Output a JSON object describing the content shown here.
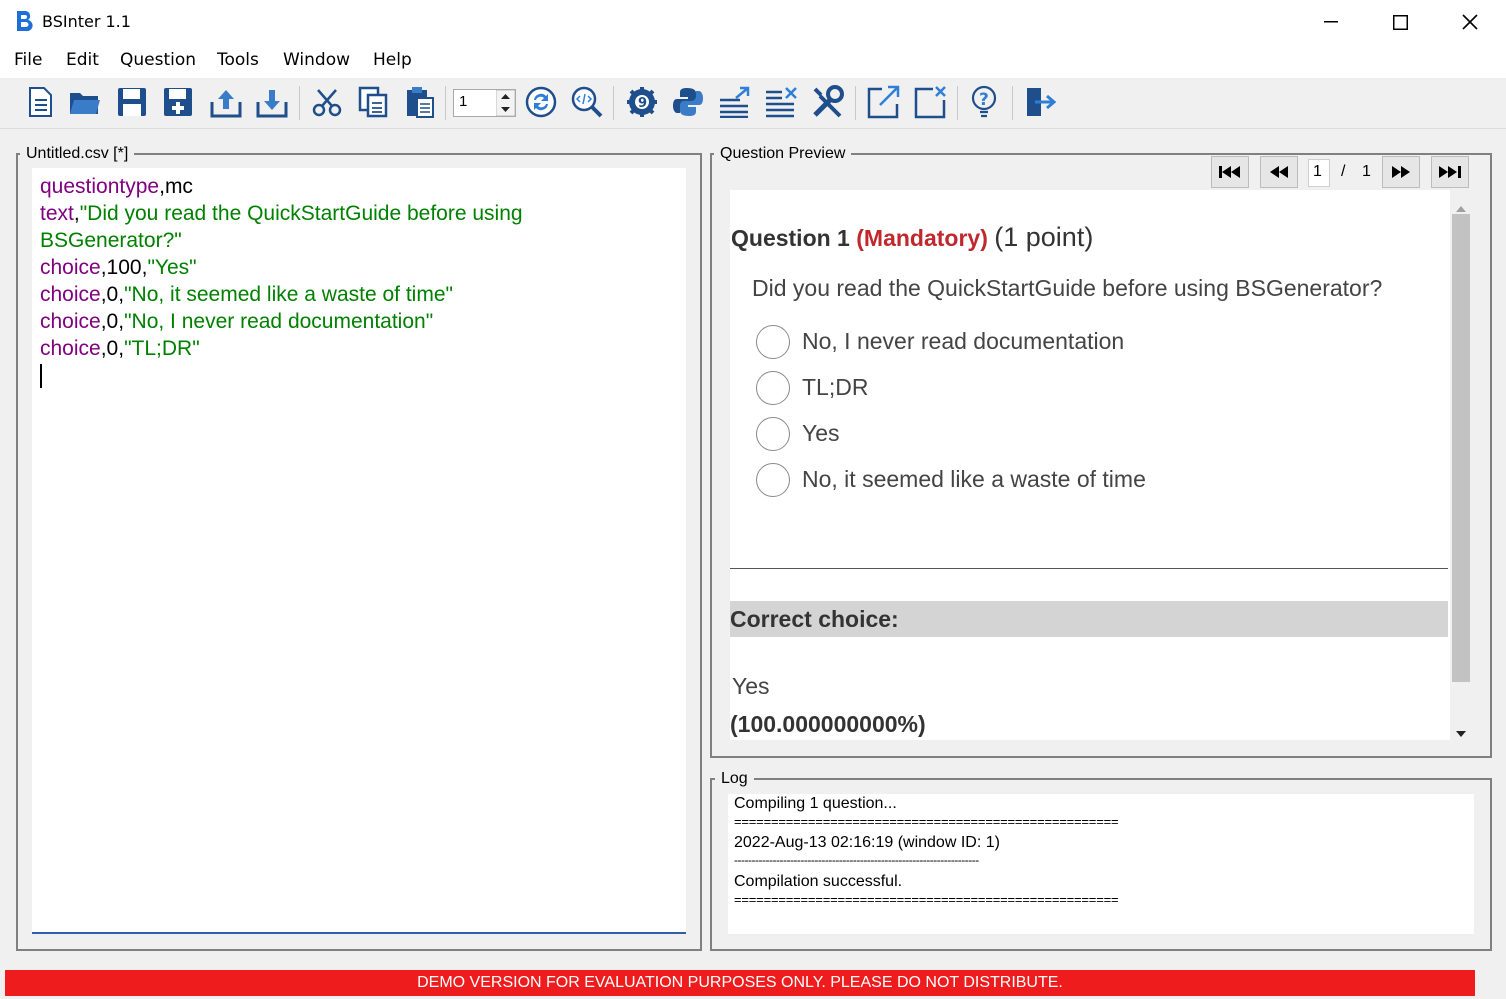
{
  "window": {
    "title": "BSInter 1.1"
  },
  "menu": [
    "File",
    "Edit",
    "Question",
    "Tools",
    "Window",
    "Help"
  ],
  "toolbar": {
    "spinbox_value": "1",
    "icons": [
      "new-file-icon",
      "open-folder-icon",
      "save-icon",
      "save-as-icon",
      "upload-icon",
      "download-icon",
      "cut-icon",
      "copy-icon",
      "paste-icon",
      "refresh-icon",
      "inspect-code-icon",
      "settings-icon",
      "python-icon",
      "export-list-icon",
      "clear-list-icon",
      "tools-icon",
      "external-link-icon",
      "close-window-icon",
      "help-icon",
      "exit-icon"
    ]
  },
  "editor": {
    "title": "Untitled.csv [*]",
    "lines": [
      {
        "kw": "questiontype",
        "sep": ",",
        "rest": "mc"
      },
      {
        "kw": "text",
        "sep": ",",
        "str": "\"Did you read the QuickStartGuide before using"
      },
      {
        "str": "BSGenerator?\""
      },
      {
        "kw": "choice",
        "sep": ",",
        "num": "100",
        "sep2": ",",
        "str": "\"Yes\""
      },
      {
        "kw": "choice",
        "sep": ",",
        "num": "0",
        "sep2": ",",
        "str": "\"No, it seemed like a waste of time\""
      },
      {
        "kw": "choice",
        "sep": ",",
        "num": "0",
        "sep2": ",",
        "str": "\"No, I never read documentation\""
      },
      {
        "kw": "choice",
        "sep": ",",
        "num": "0",
        "sep2": ",",
        "str": "\"TL;DR\""
      }
    ]
  },
  "preview": {
    "title": "Question Preview",
    "page_current": "1",
    "page_sep": "/",
    "page_total": "1",
    "question_label": "Question 1",
    "mandatory": "(Mandatory)",
    "points": "(1 point)",
    "question_text": "Did you read the QuickStartGuide before using BSGenerator?",
    "choices": [
      "No, I never read documentation",
      "TL;DR",
      "Yes",
      "No, it seemed like a waste of time"
    ],
    "correct_header": "Correct choice:",
    "correct_answer": "Yes",
    "correct_percent": "(100.000000000%)"
  },
  "log": {
    "title": "Log",
    "lines": [
      "Compiling 1 question...",
      "====================================================",
      "2022-Aug-13 02:16:19 (window ID: 1)",
      "----------------------------------------------------------------------",
      "Compilation successful.",
      "===================================================="
    ]
  },
  "status": {
    "demo_text": "DEMO VERSION FOR EVALUATION PURPOSES ONLY. PLEASE DO NOT DISTRIBUTE."
  },
  "colors": {
    "keyword": "#800080",
    "string": "#008000",
    "mandatory": "#c0282d",
    "demo_bar": "#ee1c1c"
  }
}
